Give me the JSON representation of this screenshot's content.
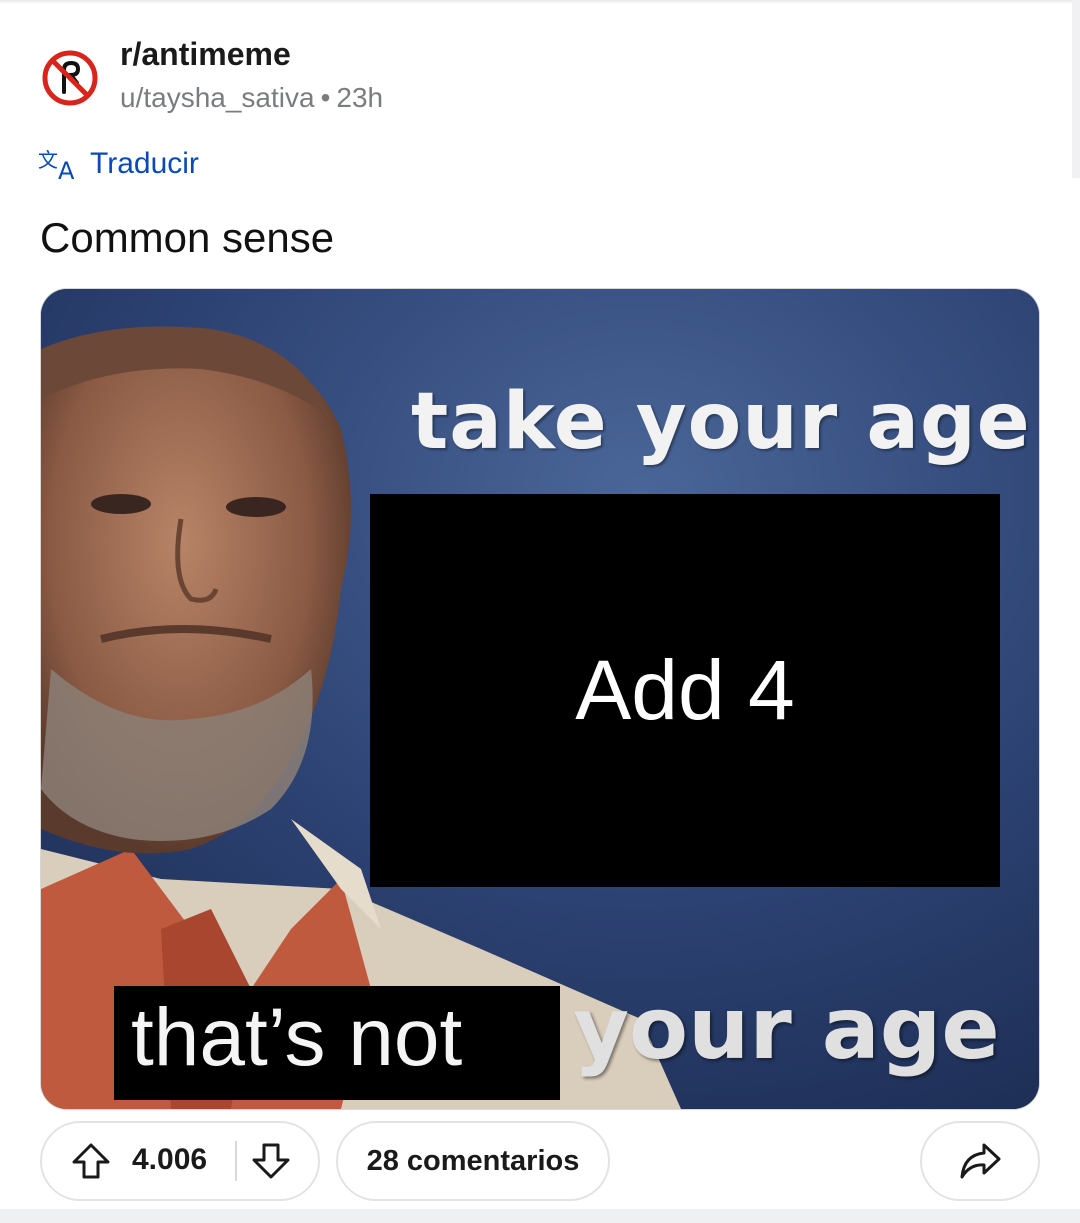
{
  "post": {
    "subreddit": "r/antimeme",
    "author": "u/taysha_sativa",
    "separator": "•",
    "age": "23h",
    "translate_label": "Traducir",
    "title": "Common sense"
  },
  "meme": {
    "top_text": "take your age",
    "box_text": "Add 4",
    "bottom_left_text": "that’s not",
    "bottom_right_text": "your age"
  },
  "actions": {
    "vote_count": "4.006",
    "comments_label": "28 comentarios"
  },
  "icons": {
    "subreddit_icon": "no-symbol-icon",
    "translate_icon": "translate-icon",
    "upvote_icon": "arrow-up-icon",
    "downvote_icon": "arrow-down-icon",
    "share_icon": "share-arrow-icon"
  },
  "colors": {
    "link_blue": "#0a49b8",
    "subreddit_icon_red": "#d6261c",
    "muted_text": "#7a7d80"
  }
}
